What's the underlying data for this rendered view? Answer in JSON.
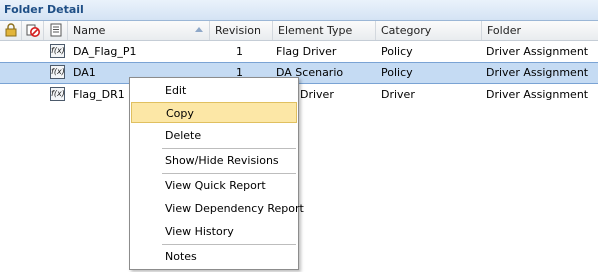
{
  "panel": {
    "title": "Folder Detail"
  },
  "header_icons": [
    "lock-icon",
    "no-entry-icon",
    "document-icon"
  ],
  "columns": {
    "name": "Name",
    "revision": "Revision",
    "element_type": "Element Type",
    "category": "Category",
    "folder": "Folder"
  },
  "rows": [
    {
      "icon": "formula-icon",
      "name": "DA_Flag_P1",
      "revision": "1",
      "element_type": "Flag Driver",
      "category": "Policy",
      "folder": "Driver Assignment",
      "selected": false
    },
    {
      "icon": "formula-icon",
      "name": "DA1",
      "revision": "1",
      "element_type": "DA Scenario",
      "category": "Policy",
      "folder": "Driver Assignment",
      "selected": true
    },
    {
      "icon": "formula-icon",
      "name": "Flag_DR1",
      "revision": "",
      "element_type": "Driver",
      "category": "Driver",
      "folder": "Driver Assignment",
      "selected": false
    }
  ],
  "context_menu": {
    "items": [
      "Edit",
      "Copy",
      "Delete",
      "Show/Hide Revisions",
      "View Quick Report",
      "View Dependency Report",
      "View History",
      "Notes"
    ],
    "highlighted": "Copy"
  },
  "colors": {
    "title": "#1f4f86",
    "selection": "#c5dbf3",
    "menu_highlight": "#fce7a6"
  }
}
